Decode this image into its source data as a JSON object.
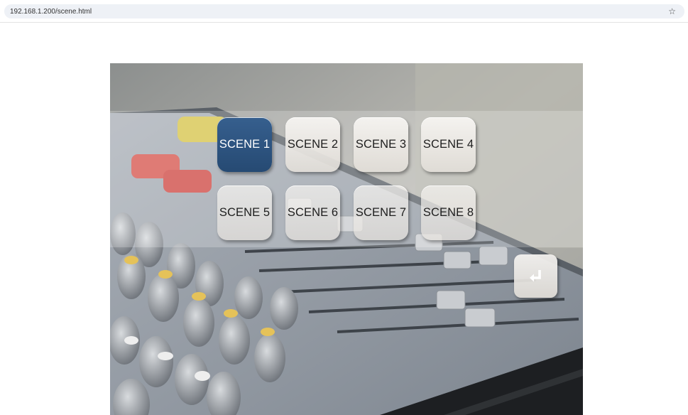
{
  "browser": {
    "url": "192.168.1.200/scene.html",
    "bookmark_icon": "star-icon"
  },
  "scenes": {
    "active": "SCENE 1",
    "buttons": [
      "SCENE 1",
      "SCENE 2",
      "SCENE 3",
      "SCENE 4",
      "SCENE 5",
      "SCENE 6",
      "SCENE 7",
      "SCENE 8"
    ]
  },
  "back_button": {
    "icon": "return-arrow-icon"
  },
  "colors": {
    "active_scene": "#2e5580",
    "scene_button": "#efece8"
  }
}
